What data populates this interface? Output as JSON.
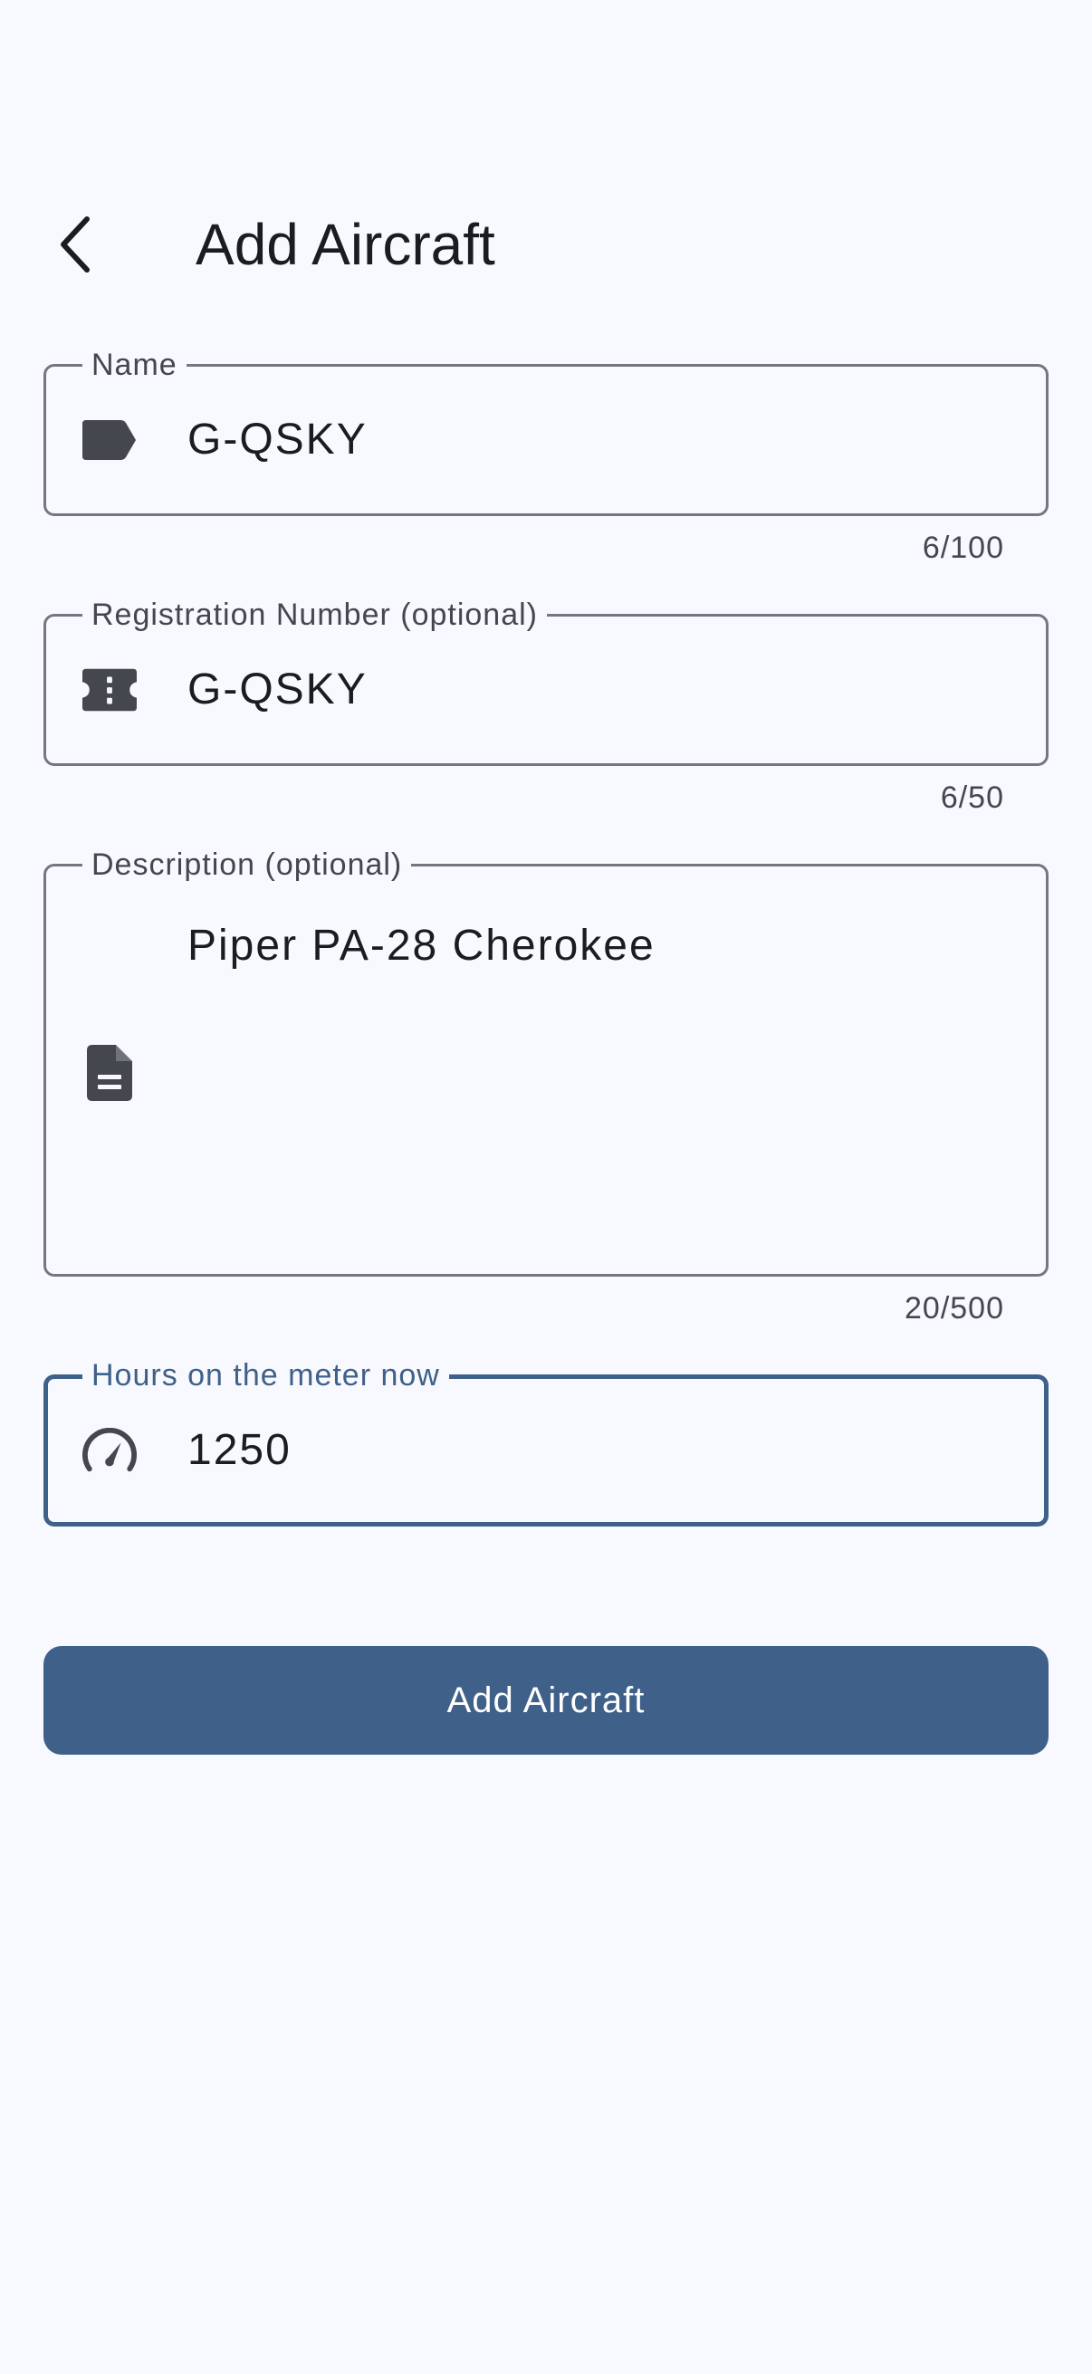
{
  "header": {
    "title": "Add Aircraft",
    "back_icon": "chevron-left-icon"
  },
  "form": {
    "name": {
      "label": "Name",
      "value": "G-QSKY",
      "counter": "6/100",
      "icon": "label-tag-icon"
    },
    "registration": {
      "label": "Registration Number (optional)",
      "value": "G-QSKY",
      "counter": "6/50",
      "icon": "ticket-icon"
    },
    "description": {
      "label": "Description (optional)",
      "value": "Piper PA-28 Cherokee",
      "counter": "20/500",
      "icon": "document-icon"
    },
    "hours": {
      "label": "Hours on the meter now",
      "value": "1250",
      "icon": "speedometer-icon",
      "focused": true
    }
  },
  "submit": {
    "label": "Add Aircraft"
  },
  "colors": {
    "background": "#f8f9ff",
    "primary": "#3f6189",
    "outline": "#74777f",
    "icon": "#44474e",
    "text": "#191c20"
  }
}
